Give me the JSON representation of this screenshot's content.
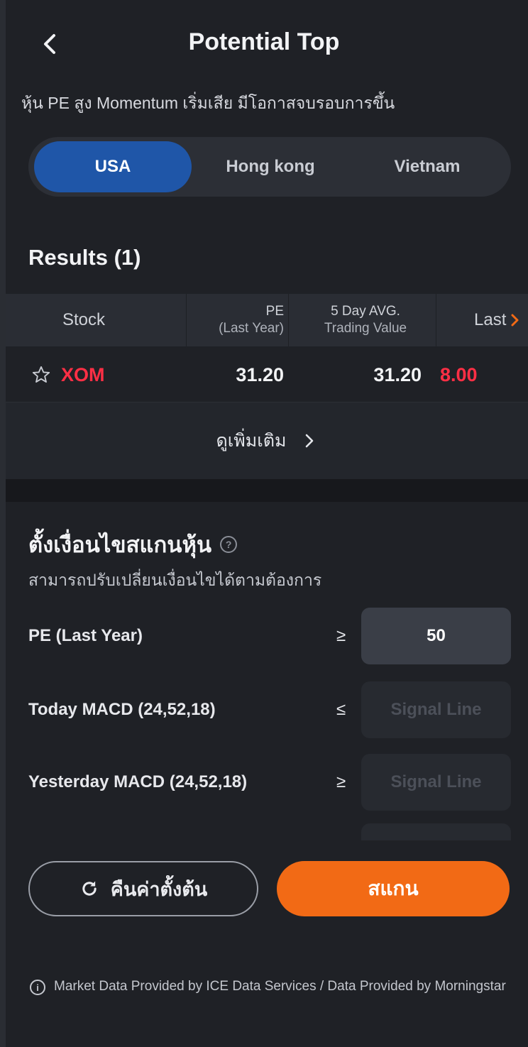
{
  "header": {
    "title": "Potential Top",
    "subtitle": "หุ้น PE สูง Momentum เริ่มเสีย มีโอกาสจบรอบการขึ้น"
  },
  "markets": {
    "tabs": [
      "USA",
      "Hong kong",
      "Vietnam"
    ],
    "selected": "USA"
  },
  "results": {
    "title": "Results (1)",
    "columns": {
      "stock": "Stock",
      "pe_line1": "PE",
      "pe_line2": "(Last Year)",
      "avg_line1": "5 Day AVG.",
      "avg_line2": "Trading Value",
      "last": "Last"
    },
    "rows": [
      {
        "symbol": "XOM",
        "pe": "31.20",
        "avg": "31.20",
        "last": "8.00"
      }
    ],
    "more_label": "ดูเพิ่มเติม"
  },
  "conditions": {
    "title": "ตั้งเงื่อนไขสแกนหุ้น",
    "subtitle": "สามารถปรับเปลี่ยนเงื่อนไขได้ตามต้องการ",
    "items": [
      {
        "label": "PE (Last Year)",
        "op": "≥",
        "value": "50"
      },
      {
        "label": "Today MACD (24,52,18)",
        "op": "≤",
        "value": "Signal Line"
      },
      {
        "label": "Yesterday MACD (24,52,18)",
        "op": "≥",
        "value": "Signal Line"
      }
    ]
  },
  "actions": {
    "reset_label": "คืนค่าตั้งต้น",
    "scan_label": "สแกน"
  },
  "footer": {
    "disclaimer": "Market Data Provided by ICE Data Services / Data Provided by Morningstar"
  },
  "colors": {
    "accent_blue": "#1f56a8",
    "scan_orange": "#f26a15",
    "negative_red": "#ff2f45"
  }
}
